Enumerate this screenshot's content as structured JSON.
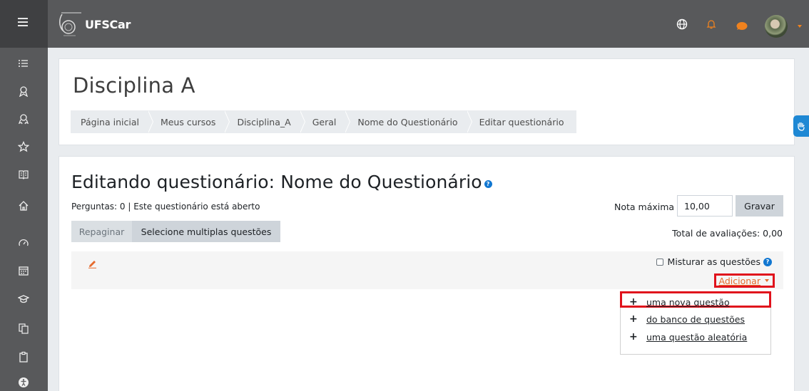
{
  "navbar": {
    "brand": "UFSCar",
    "icons": [
      "menu-icon",
      "globe-icon",
      "bell-icon",
      "chat-icon",
      "avatar"
    ]
  },
  "rail": {
    "icons": [
      "list-icon",
      "badge-icon",
      "award-icon",
      "star-icon",
      "book-icon",
      "home-icon",
      "dashboard-icon",
      "calendar-icon",
      "graduation-icon",
      "files-icon",
      "clipboard-icon",
      "accessibility-icon"
    ]
  },
  "header": {
    "title": "Disciplina A",
    "breadcrumb": [
      "Página inicial",
      "Meus cursos",
      "Disciplina_A",
      "Geral",
      "Nome do Questionário",
      "Editar questionário"
    ]
  },
  "main": {
    "title": "Editando questionário: Nome do Questionário",
    "info": "Perguntas: 0 | Este questionário está aberto",
    "maxgrade_label": "Nota máxima",
    "maxgrade_value": "10,00",
    "save_label": "Gravar",
    "repaginate_label": "Repaginar",
    "multi_select_label": "Selecione multiplas questões",
    "total_grades": "Total de avaliações: 0,00",
    "shuffle_label": "Misturar as questões",
    "add_label": "Adicionar"
  },
  "dropdown": {
    "items": [
      "uma nova questão",
      "do banco de questões",
      "uma questão aleatória"
    ]
  },
  "colors": {
    "navbar": "#58595b",
    "accent_orange": "#f0821e",
    "highlight_red": "#e0121c",
    "link_blue": "#1177d1"
  }
}
